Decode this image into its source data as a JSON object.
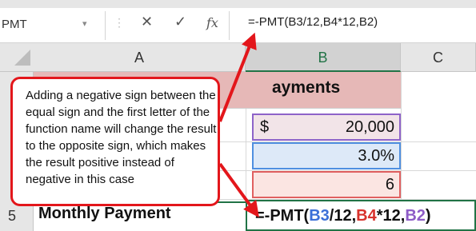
{
  "formula_bar": {
    "name_box": "PMT",
    "name_box_arrow": "▾",
    "grip": "⋮",
    "cancel_icon": "✕",
    "enter_icon": "✓",
    "fx_label": "fx",
    "formula": "=-PMT(B3/12,B4*12,B2)"
  },
  "columns": [
    "A",
    "B",
    "C"
  ],
  "rows": {
    "row5_number": "5",
    "title_fragment": "ayments",
    "b2_currency": "$",
    "b2_value": "20,000",
    "b3_value": "3.0%",
    "b4_value": "6",
    "a5_label": "Monthly Payment"
  },
  "formula_cell": {
    "p1": "=-PMT(",
    "ref1": "B3",
    "p2": "/12,",
    "ref2": "B4",
    "p3": "*12,",
    "ref3": "B2",
    "p4": ")"
  },
  "callout": {
    "text": "Adding a negative sign between the equal sign and the first letter of the function name will change the result to the opposite sign, which makes the result positive instead of negative in this case"
  },
  "colors": {
    "callout_border": "#e3161b",
    "arrow": "#e3161b",
    "ref_b3": "#3b6fd8",
    "ref_b4": "#d8322c",
    "ref_b2": "#8e5cc7",
    "selection": "#217346"
  }
}
